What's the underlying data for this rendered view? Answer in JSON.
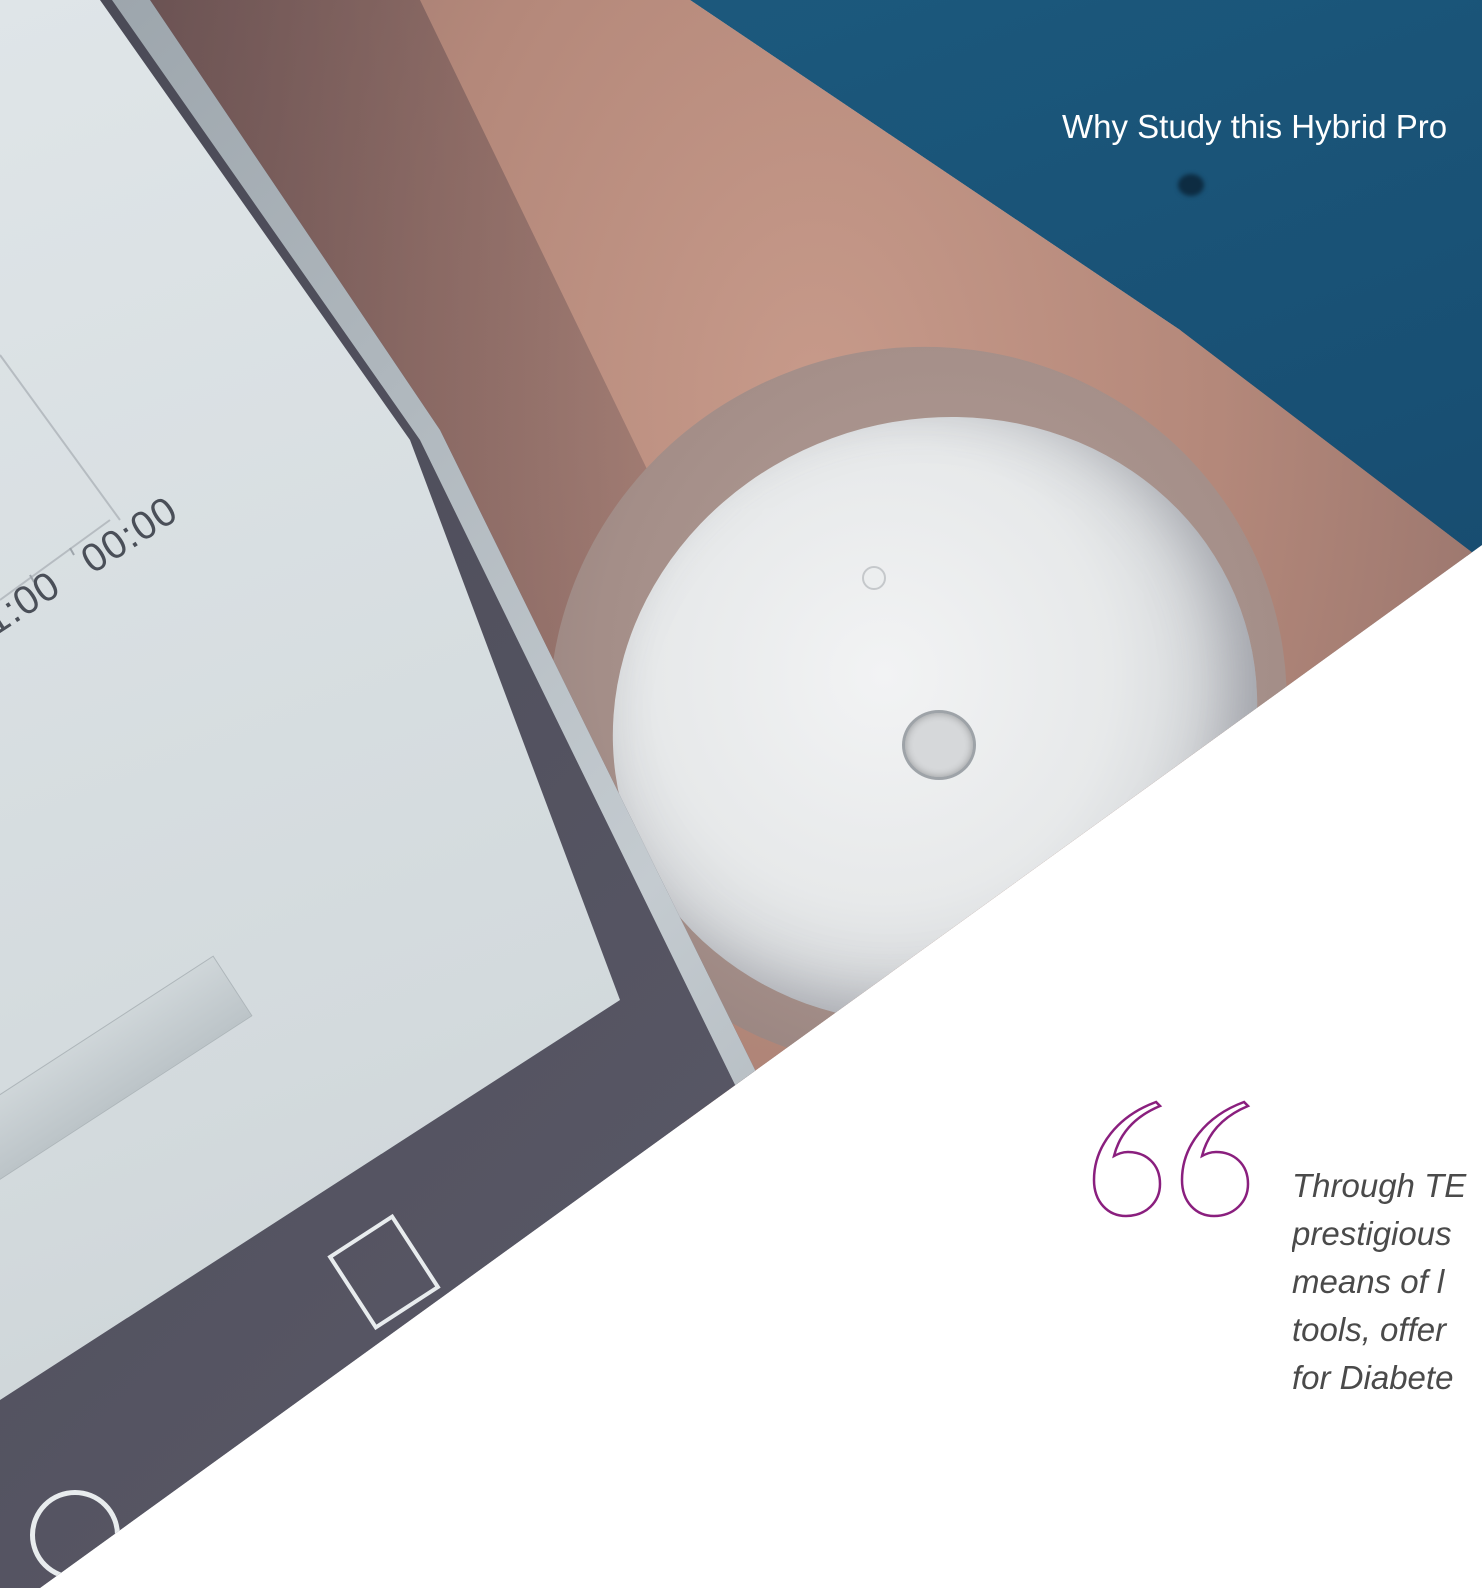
{
  "section": {
    "title": "Why Study this Hybrid Pro"
  },
  "screen": {
    "time_labels": [
      "1:00",
      "00:00"
    ]
  },
  "quote": {
    "icon": "quotation-mark-icon",
    "accent_color": "#8a1f7e",
    "lines": [
      "Through TE",
      "prestigious",
      "means of l",
      "tools, offer",
      "for Diabete"
    ]
  },
  "colors": {
    "blue_band": "#184f73",
    "text_gray": "#4a4a4a"
  }
}
